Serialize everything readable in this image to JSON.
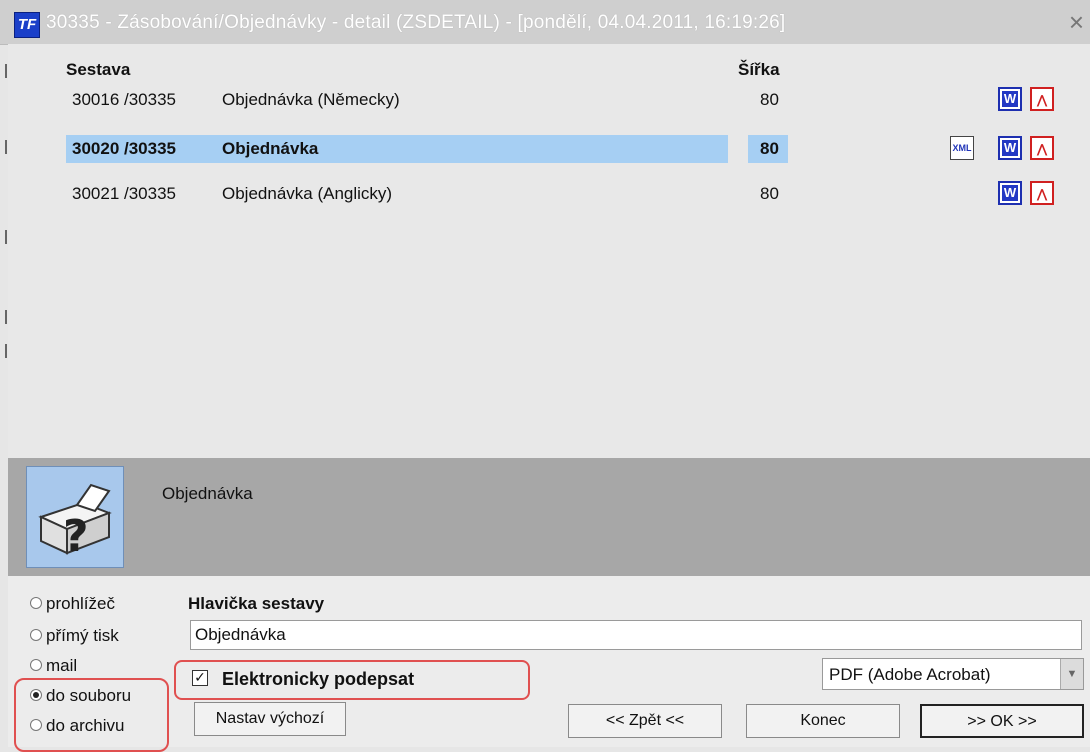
{
  "window": {
    "title": "30335 - Zásobování/Objednávky - detail (ZSDETAIL) - [pondělí, 04.04.2011, 16:19:26]",
    "logo": "TF",
    "close_glyph": "×"
  },
  "list": {
    "columns": {
      "sestava": "Sestava",
      "sirka": "Šířka"
    },
    "rows": [
      {
        "code": "30016 /30335",
        "name": "Objednávka (Německy)",
        "width": "80",
        "selected": false,
        "icons": [
          "word-icon",
          "pdf-icon"
        ]
      },
      {
        "code": "30020 /30335",
        "name": "Objednávka",
        "width": "80",
        "selected": true,
        "icons": [
          "xml-icon",
          "word-icon",
          "pdf-icon"
        ]
      },
      {
        "code": "30021 /30335",
        "name": "Objednávka (Anglicky)",
        "width": "80",
        "selected": false,
        "icons": [
          "word-icon",
          "pdf-icon"
        ]
      }
    ]
  },
  "info": {
    "text": "Objednávka",
    "icon": "printer-help-icon"
  },
  "output": {
    "options": [
      {
        "label": "prohlížeč",
        "checked": false
      },
      {
        "label": "přímý tisk",
        "checked": false
      },
      {
        "label": "mail",
        "checked": false
      },
      {
        "label": "do souboru",
        "checked": true
      },
      {
        "label": "do archivu",
        "checked": false
      }
    ]
  },
  "header_field": {
    "label": "Hlavička sestavy",
    "value": "Objednávka"
  },
  "sign": {
    "label": "Elektronicky podepsat",
    "checked": true
  },
  "format_select": {
    "value": "PDF (Adobe Acrobat)"
  },
  "buttons": {
    "default": "Nastav výchozí",
    "back": "<< Zpět <<",
    "end": "Konec",
    "ok": ">> OK >>"
  },
  "colors": {
    "selection": "#a6cff3",
    "highlight_ring": "#e05050",
    "word": "#1d2fb0",
    "pdf": "#d02020"
  }
}
